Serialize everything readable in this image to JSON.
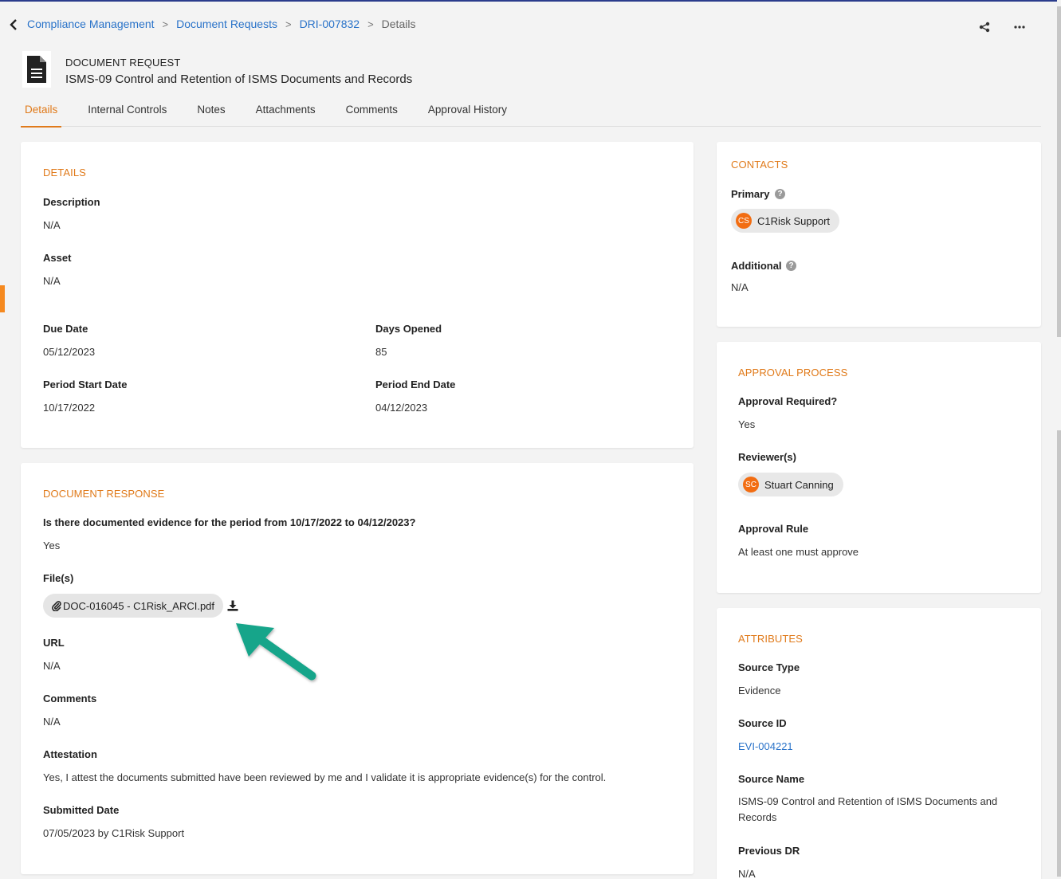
{
  "breadcrumb": {
    "items": [
      "Compliance Management",
      "Document Requests",
      "DRI-007832"
    ],
    "current": "Details",
    "separator": ">"
  },
  "header": {
    "type_label": "DOCUMENT REQUEST",
    "title": "ISMS-09 Control and Retention of ISMS Documents and Records"
  },
  "tabs": [
    "Details",
    "Internal Controls",
    "Notes",
    "Attachments",
    "Comments",
    "Approval History"
  ],
  "details": {
    "section_title": "DETAILS",
    "description_label": "Description",
    "description_value": "N/A",
    "asset_label": "Asset",
    "asset_value": "N/A",
    "due_date_label": "Due Date",
    "due_date_value": "05/12/2023",
    "days_opened_label": "Days Opened",
    "days_opened_value": "85",
    "period_start_label": "Period Start Date",
    "period_start_value": "10/17/2022",
    "period_end_label": "Period End Date",
    "period_end_value": "04/12/2023"
  },
  "response": {
    "section_title": "DOCUMENT RESPONSE",
    "question": "Is there documented evidence for the period from 10/17/2022 to 04/12/2023?",
    "answer": "Yes",
    "files_label": "File(s)",
    "file_name": "DOC-016045 - C1Risk_ARCI.pdf",
    "url_label": "URL",
    "url_value": "N/A",
    "comments_label": "Comments",
    "comments_value": "N/A",
    "attestation_label": "Attestation",
    "attestation_value": "Yes, I attest the documents submitted have been reviewed by me and I validate it is appropriate evidence(s) for the control.",
    "submitted_label": "Submitted Date",
    "submitted_value": "07/05/2023 by C1Risk Support"
  },
  "contacts": {
    "section_title": "CONTACTS",
    "primary_label": "Primary",
    "primary_initials": "CS",
    "primary_name": "C1Risk Support",
    "additional_label": "Additional",
    "additional_value": "N/A",
    "help_glyph": "?"
  },
  "approval": {
    "section_title": "APPROVAL PROCESS",
    "required_label": "Approval Required?",
    "required_value": "Yes",
    "reviewers_label": "Reviewer(s)",
    "reviewer_initials": "SC",
    "reviewer_name": "Stuart Canning",
    "rule_label": "Approval Rule",
    "rule_value": "At least one must approve"
  },
  "attributes": {
    "section_title": "ATTRIBUTES",
    "source_type_label": "Source Type",
    "source_type_value": "Evidence",
    "source_id_label": "Source ID",
    "source_id_value": "EVI-004221",
    "source_name_label": "Source Name",
    "source_name_value": "ISMS-09 Control and Retention of ISMS Documents and Records",
    "previous_dr_label": "Previous DR",
    "previous_dr_value": "N/A"
  },
  "colors": {
    "accent": "#e07a1a",
    "link": "#2a73c9",
    "avatar": "#f26d12",
    "arrow": "#14a58a",
    "topline": "#2a3c8c"
  },
  "icons": [
    "chevron-left-icon",
    "share-icon",
    "more-horizontal-icon",
    "document-icon",
    "help-icon",
    "paperclip-icon",
    "download-icon",
    "pointer-arrow-icon"
  ]
}
